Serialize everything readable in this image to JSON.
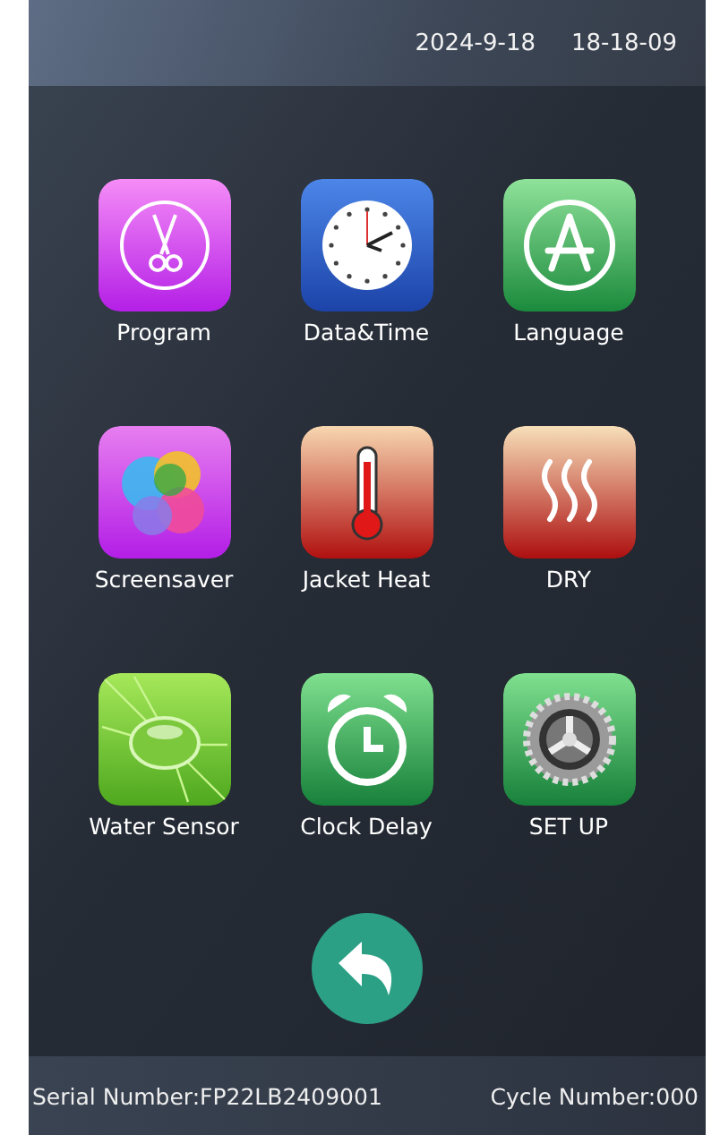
{
  "status_bar": {
    "date": "2024-9-18",
    "time": "18-18-09"
  },
  "menu": [
    {
      "label": "Program",
      "kind": "scissors"
    },
    {
      "label": "Data&Time",
      "kind": "clock"
    },
    {
      "label": "Language",
      "kind": "appstore"
    },
    {
      "label": "Screensaver",
      "kind": "bubbles"
    },
    {
      "label": "Jacket Heat",
      "kind": "thermometer"
    },
    {
      "label": "DRY",
      "kind": "heat"
    },
    {
      "label": "Water Sensor",
      "kind": "leaf"
    },
    {
      "label": "Clock Delay",
      "kind": "alarm"
    },
    {
      "label": "SET UP",
      "kind": "gear"
    }
  ],
  "footer": {
    "serial": "Serial Number:FP22LB2409001",
    "cycle": "Cycle Number:000"
  }
}
